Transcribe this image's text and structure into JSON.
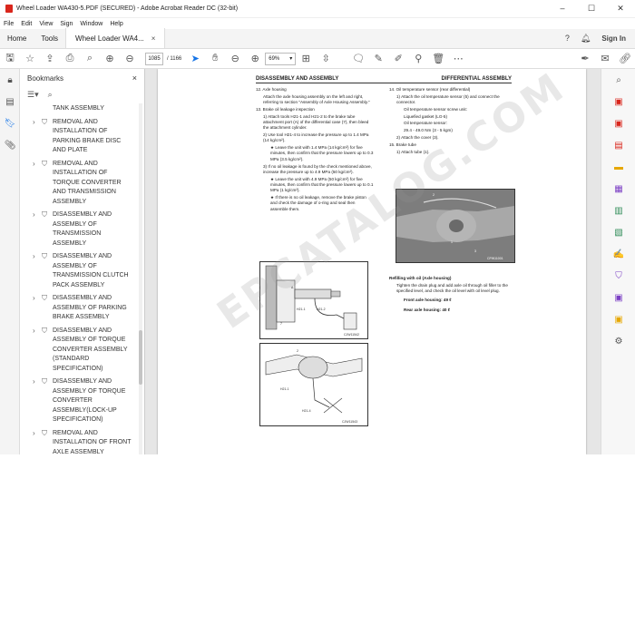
{
  "window": {
    "title": "Wheel Loader WA430-5.PDF (SECURED) - Adobe Acrobat Reader DC (32-bit)",
    "controls": [
      "–",
      "☐",
      "✕"
    ]
  },
  "menu": [
    "File",
    "Edit",
    "View",
    "Sign",
    "Window",
    "Help"
  ],
  "tabs": {
    "home": "Home",
    "tools": "Tools",
    "doc": "Wheel Loader WA4...",
    "doc_close": "×",
    "sign_in": "Sign In"
  },
  "toolbar": {
    "page_current": "1085",
    "page_total": "/ 1166",
    "zoom": "69%"
  },
  "bookmarks": {
    "title": "Bookmarks",
    "close": "×",
    "partial_top": "TANK ASSEMBLY",
    "items": [
      "REMOVAL AND INSTALLATION OF PARKING BRAKE DISC AND PLATE",
      "REMOVAL AND INSTALLATION OF TORQUE CONVERTER AND TRANSMISSION ASSEMBLY",
      "DISASSEMBLY AND ASSEMBLY OF TRANSMISSION ASSEMBLY",
      "DISASSEMBLY AND ASSEMBLY OF TRANSMISSION CLUTCH PACK ASSEMBLY",
      "DISASSEMBLY AND ASSEMBLY OF PARKING BRAKE ASSEMBLY",
      "DISASSEMBLY AND ASSEMBLY OF TORQUE CONVERTER ASSEMBLY (STANDARD SPECIFICATION)",
      "DISASSEMBLY AND ASSEMBLY OF TORQUE CONVERTER ASSEMBLY(LOCK-UP SPECIFICATION)",
      "REMOVAL AND INSTALLATION OF FRONT AXLE ASSEMBLY"
    ]
  },
  "page": {
    "header_left": "DISASSEMBLY AND ASSEMBLY",
    "header_right": "DIFFERENTIAL ASSEMBLY",
    "watermark": "EPCATALOG.COM",
    "left": [
      {
        "t": "12. Axle housing",
        "c": ""
      },
      {
        "t": "Attach the axle housing assembly on the left and right, referring to section \"Assembly of Axle Housing Assembly.\"",
        "c": "ind1"
      },
      {
        "t": "13. Brake oil leakage inspection",
        "c": ""
      },
      {
        "t": "1)  Attach tools H21-1 and H21-2 to the brake tube attachment port (A) of the differential case (7), then bleed the attachment cylinder.",
        "c": "ind1"
      },
      {
        "t": "2)  Use tool H21-4 to increase the pressure up to 1.4 MPa (14 kg/cm²).",
        "c": "ind1"
      },
      {
        "t": "★  Leave the unit with 1.4 MPa (14 kg/cm²) for five minutes, then confirm that the pressure lowers up to 0.3 MPa (3.5 kg/cm²).",
        "c": "ind2"
      },
      {
        "t": "3)  If no oil leakage is found by the check mentioned above, increase the pressure up to 4.9 MPa (50 kg/cm²).",
        "c": "ind1"
      },
      {
        "t": "★  Leave the unit with 4.9 MPa (50 kg/cm²) for five minutes, then confirm that the pressure lowers up to 0.1 MPa (1 kg/cm²).",
        "c": "ind2"
      },
      {
        "t": "★  If there is no oil leakage, remove the brake piston and check the damage of o-ring and seal then assemble them.",
        "c": "ind2"
      }
    ],
    "right": [
      {
        "t": "14. Oil temperature sensor (rear differential)",
        "c": ""
      },
      {
        "t": "1)  Attach the oil temperature sensor (5) and connect the connector.",
        "c": "ind1"
      },
      {
        "t": "Oil temperature sensor screw unit:",
        "c": "ind2"
      },
      {
        "t": "Liquefied gasket (LG-5)",
        "c": "ind2"
      },
      {
        "t": "Oil temperature sensor:",
        "c": "ind2"
      },
      {
        "t": "29.4 - 49.0 Nm (3 - 5 kgm)",
        "c": "ind2"
      },
      {
        "t": "2)  Attach the cover (3).",
        "c": "ind1"
      },
      {
        "t": "15. Brake tube",
        "c": ""
      },
      {
        "t": "1)  Attach tube (1).",
        "c": "ind1"
      }
    ],
    "refill_title": "Refilling with oil (Axle housing)",
    "refill_text": "Tighten the drain plug and add axle oil through oil filler to the specified level, and check the oil level with oil level plug.",
    "front_axle": "Front axle housing: 49 ℓ",
    "rear_axle": "Rear axle housing: 40 ℓ",
    "fig1_labels": [
      "A",
      "H21-1",
      "H21-2",
      "7"
    ],
    "fig1_code": "CJW11542",
    "fig2_labels": [
      "H21-1",
      "H21-4",
      "2"
    ],
    "fig2_code": "CJW11543",
    "photo_labels": [
      "2",
      "1",
      "3"
    ],
    "photo_code": "CPW11001"
  }
}
